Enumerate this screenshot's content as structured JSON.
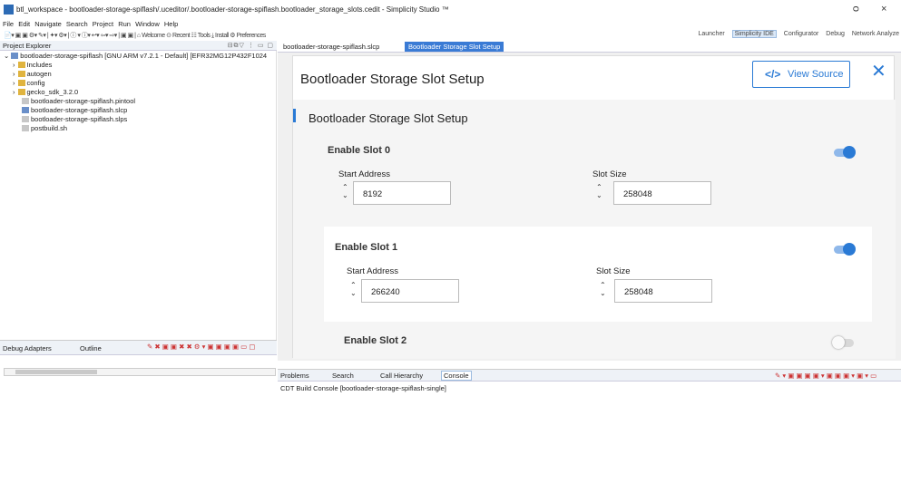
{
  "window": {
    "title": "btl_workspace - bootloader-storage-spiflash/.uceditor/.bootloader-storage-spiflash.bootloader_storage_slots.cedit - Simplicity Studio ™",
    "minimize": "ᴑ",
    "close": "×"
  },
  "menu": [
    "File",
    "Edit",
    "Navigate",
    "Search",
    "Project",
    "Run",
    "Window",
    "Help"
  ],
  "toolbar": {
    "icons": "📄▾ ▣ ▣ ⚙▾ ✎▾ | ✦▾ ⚙▾ | ⓘ ▾ ⓘ▾ ↩▾ ⇦▾ ⇨▾ | ▣ ▣ |",
    "welcome": "Welcome",
    "recent": "Recent",
    "tools": "Tools",
    "install": "Install",
    "preferences": "Preferences"
  },
  "perspectives": [
    "Launcher",
    "Simplicity IDE",
    "Configurator",
    "Debug",
    "Network Analyze"
  ],
  "project_explorer": {
    "title": "Project Explorer",
    "icons": "⊟⧉▽ ⋮ ▭ ▢",
    "tree": [
      {
        "label": "bootloader-storage-spiflash [GNU ARM v7.2.1 - Default] [EFR32MG12P432F1024",
        "indent": 0,
        "kind": "proj"
      },
      {
        "label": "Includes",
        "indent": 1,
        "kind": "folder"
      },
      {
        "label": "autogen",
        "indent": 1,
        "kind": "folder"
      },
      {
        "label": "config",
        "indent": 1,
        "kind": "folder"
      },
      {
        "label": "gecko_sdk_3.2.0",
        "indent": 1,
        "kind": "folder"
      },
      {
        "label": "bootloader-storage-spiflash.pintool",
        "indent": 2,
        "kind": "file"
      },
      {
        "label": "bootloader-storage-spiflash.slcp",
        "indent": 2,
        "kind": "proj"
      },
      {
        "label": "bootloader-storage-spiflash.slps",
        "indent": 2,
        "kind": "file"
      },
      {
        "label": "postbuild.sh",
        "indent": 2,
        "kind": "file"
      }
    ]
  },
  "bottom_left": {
    "debug_tab": "Debug Adapters",
    "outline_tab": "Outline",
    "icons": "✎ ✖ ▣ ▣ ✖ ✖ ⚙ ▾ ▣ ▣ ▣ ▣ ▭ ▢"
  },
  "editor_tabs": [
    {
      "label": "bootloader-storage-spiflash.slcp",
      "active": false
    },
    {
      "label": "Bootloader Storage Slot Setup",
      "active": true
    }
  ],
  "editor": {
    "header_title": "Bootloader Storage Slot Setup",
    "view_source_icon": "</>",
    "view_source_label": "View Source",
    "close": "✕",
    "section_title": "Bootloader Storage Slot Setup",
    "start_address_label": "Start Address",
    "slot_size_label": "Slot Size",
    "slots": [
      {
        "label": "Enable Slot 0",
        "enabled": true,
        "start_address": "8192",
        "slot_size": "258048"
      },
      {
        "label": "Enable Slot 1",
        "enabled": true,
        "start_address": "266240",
        "slot_size": "258048"
      },
      {
        "label": "Enable Slot 2",
        "enabled": false
      }
    ]
  },
  "console": {
    "tabs": [
      "Problems",
      "Search",
      "Call Hierarchy",
      "Console"
    ],
    "active_tab": "Console",
    "text": "CDT Build Console [bootloader-storage-spiflash-single]",
    "icons": "✎ ▾ ▣ ▣ ▣ ▣ ▾ ▣ ▣ ▣ ▾ ▣ ▾ ▭"
  },
  "colors": {
    "accent": "#2a7ad5",
    "toggle_on": "#2a7ad5",
    "toggle_off": "#d8d8d8"
  }
}
